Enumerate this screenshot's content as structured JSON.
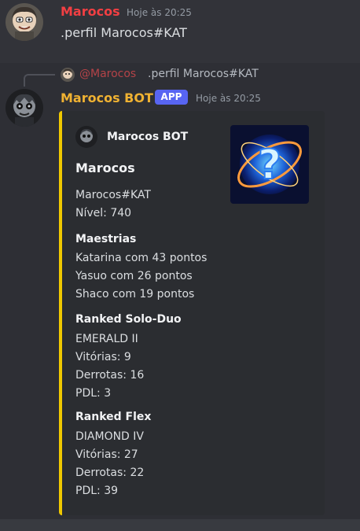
{
  "message1": {
    "username": "Marocos",
    "timestamp": "Hoje às 20:25",
    "content": ".perfil Marocos#KAT"
  },
  "message2": {
    "reply": {
      "mention": "@Marocos",
      "text": ".perfil Marocos#KAT"
    },
    "username": "Marocos BOT",
    "badge": "APP",
    "timestamp": "Hoje às 20:25",
    "embed": {
      "accent_color": "#f0c800",
      "author": "Marocos BOT",
      "title": "Marocos",
      "description_lines": [
        "Marocos#KAT",
        "Nível: 740"
      ],
      "fields": [
        {
          "name": "Maestrias",
          "lines": [
            "Katarina com 43 pontos",
            "Yasuo com 26 pontos",
            "Shaco com 19 pontos"
          ]
        },
        {
          "name": "Ranked Solo-Duo",
          "lines": [
            "EMERALD II",
            "Vitórias: 9",
            "Derrotas: 16",
            "PDL: 3"
          ]
        },
        {
          "name": "Ranked Flex",
          "lines": [
            "DIAMOND IV",
            "Vitórias: 27",
            "Derrotas: 22",
            "PDL: 39"
          ]
        }
      ]
    }
  },
  "colors": {
    "background": "#323339",
    "highlight_background": "#2e2f35",
    "embed_background": "#2b2d31",
    "username_red": "#f23f43",
    "username_bot": "#f0b232",
    "app_badge": "#5865f2"
  },
  "icons": {
    "user_avatar": "caricature-avatar-icon",
    "bot_avatar": "dark-character-avatar-icon",
    "embed_thumbnail": "question-mark-orb-icon"
  }
}
